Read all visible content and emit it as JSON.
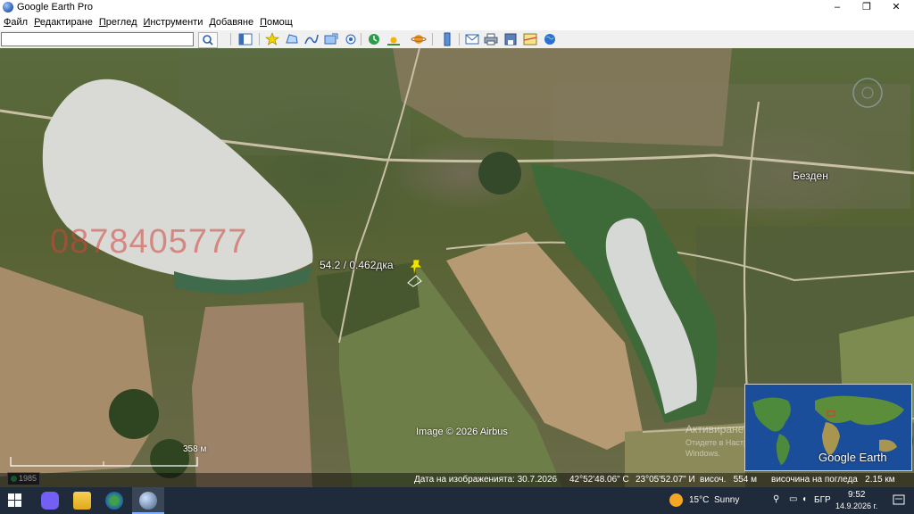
{
  "window": {
    "title": "Google Earth Pro",
    "minimize": "–",
    "maximize": "❐",
    "close": "✕"
  },
  "menu": [
    "Файл",
    "Редактиране",
    "Преглед",
    "Инструменти",
    "Добавяне",
    "Помощ"
  ],
  "search": {
    "value": "",
    "placeholder": ""
  },
  "map": {
    "watermark_phone": "0878405777",
    "placemark_label": "54.2 / 0.462дка",
    "place_name": "Безден",
    "imagery_credit": "Image © 2026 Airbus",
    "scale_label": "358 м",
    "history_year": "1985",
    "watermark_activate_title": "Активиране на Windows",
    "watermark_activate_sub": "Отидете в Настройките, за да активирате",
    "watermark_activate_sub2": "Windows.",
    "google_earth_logo": "Google Earth"
  },
  "statusbar": {
    "imagery_date": "Дата на изображенията: 30.7.2026",
    "latitude": "42°52'48.06\" С",
    "longitude": "23°05'52.07\" И",
    "elevation": "височ.   554 м",
    "eye_alt": "височина на погледа   2.15 км"
  },
  "taskbar": {
    "weather_temp": "15°C",
    "weather_desc": "Sunny",
    "language": "БГР",
    "time": "9:52",
    "date": "14.9.2026 г."
  },
  "colors": {
    "taskbar_bg": "#1f2a3a",
    "pin": "#f2e600",
    "lake": "#dcdcdc",
    "watermark_red": "#d0463e"
  }
}
